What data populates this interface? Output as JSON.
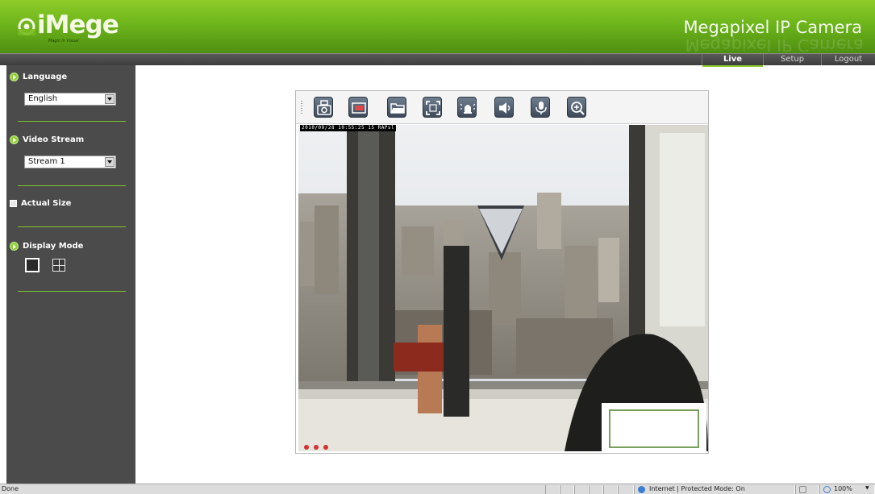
{
  "header": {
    "logo_text": "iMege",
    "logo_tagline": "Magic in Visual",
    "product_title": "Megapixel IP Camera"
  },
  "nav": {
    "tabs": [
      {
        "label": "Live",
        "active": true
      },
      {
        "label": "Setup",
        "active": false
      },
      {
        "label": "Logout",
        "active": false
      }
    ]
  },
  "sidebar": {
    "language": {
      "label": "Language",
      "value": "English"
    },
    "video_stream": {
      "label": "Video Stream",
      "value": "Stream 1"
    },
    "actual_size": {
      "label": "Actual Size",
      "checked": false
    },
    "display_mode": {
      "label": "Display Mode",
      "modes": [
        "single-view",
        "quad-view"
      ],
      "selected": "single-view"
    }
  },
  "viewer": {
    "toolbar_icons": [
      "snapshot-icon",
      "record-icon",
      "folder-icon",
      "fullscreen-icon",
      "alarm-icon",
      "speaker-icon",
      "microphone-icon",
      "zoom-in-icon"
    ],
    "timestamp": "2010/09/28 10:55:25 15 RAPsl"
  },
  "statusbar": {
    "left_text": "Done",
    "zone_text": "Internet | Protected Mode: On",
    "zoom_text": "100%"
  },
  "colors": {
    "brand_green": "#6db51b",
    "sidebar_bg": "#4b4b4b",
    "divider_green": "#7cc52a"
  }
}
